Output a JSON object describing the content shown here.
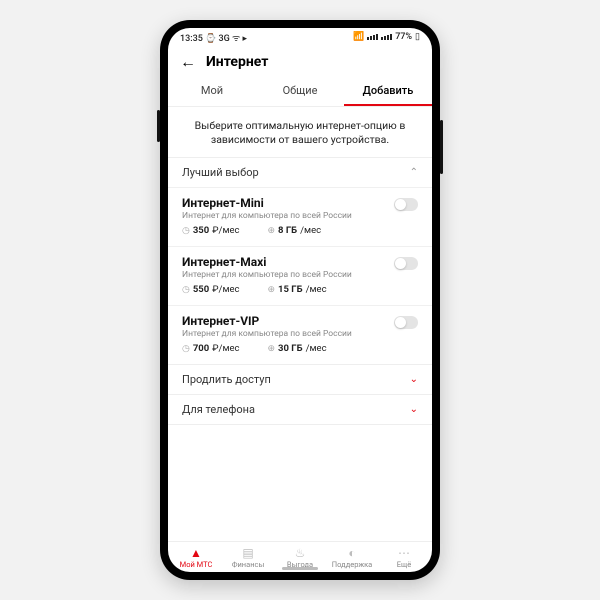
{
  "status": {
    "time": "13:35",
    "battery": "77%"
  },
  "header": {
    "title": "Интернет"
  },
  "tabs": {
    "t0": "Мой",
    "t1": "Общие",
    "t2": "Добавить"
  },
  "intro": "Выберите оптимальную интернет-опцию в зависимости от вашего устройства.",
  "sections": {
    "best": "Лучший выбор",
    "extend": "Продлить доступ",
    "phone": "Для телефона"
  },
  "plans": [
    {
      "title": "Интернет-Mini",
      "sub": "Интернет для компьютера по всей России",
      "price": "350",
      "price_unit": "₽/мес",
      "data": "8 ГБ",
      "data_unit": "/мес"
    },
    {
      "title": "Интернет-Maxi",
      "sub": "Интернет для компьютера по всей России",
      "price": "550",
      "price_unit": "₽/мес",
      "data": "15 ГБ",
      "data_unit": "/мес"
    },
    {
      "title": "Интернет-VIP",
      "sub": "Интернет для компьютера по всей России",
      "price": "700",
      "price_unit": "₽/мес",
      "data": "30 ГБ",
      "data_unit": "/мес"
    }
  ],
  "nav": {
    "i0": "Мой МТС",
    "i1": "Финансы",
    "i2": "Выгода",
    "i3": "Поддержка",
    "i4": "Ещё"
  }
}
